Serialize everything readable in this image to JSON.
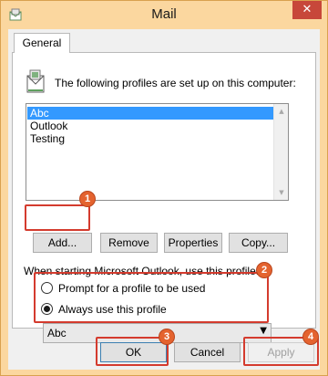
{
  "window": {
    "title": "Mail",
    "close_glyph": "✕"
  },
  "tabs": [
    {
      "label": "General"
    }
  ],
  "heading": "The following profiles are set up on this computer:",
  "profiles": [
    "Abc",
    "Outlook",
    "Testing"
  ],
  "selected_profile_index": 0,
  "profile_buttons": {
    "add": "Add...",
    "remove": "Remove",
    "properties": "Properties",
    "copy": "Copy..."
  },
  "startup": {
    "label": "When starting Microsoft Outlook, use this profile:",
    "prompt_option": "Prompt for a profile to be used",
    "always_option": "Always use this profile",
    "selected_option": "always",
    "profile_select_value": "Abc"
  },
  "dialog_buttons": {
    "ok": "OK",
    "cancel": "Cancel",
    "apply": "Apply"
  },
  "step_badges": [
    "1",
    "2",
    "3",
    "4"
  ],
  "colors": {
    "highlight": "#d43b2e",
    "badge": "#e4632f",
    "selection": "#3399ff",
    "title_bar": "#fbd79f"
  }
}
